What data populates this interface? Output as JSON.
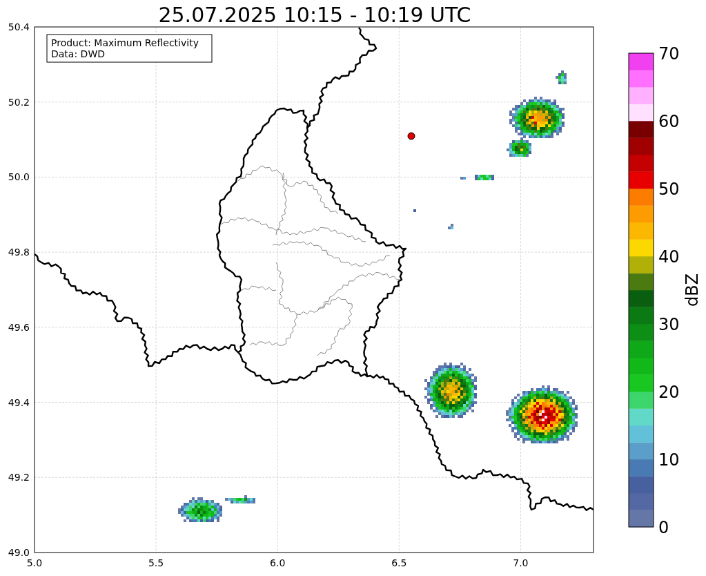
{
  "title": "25.07.2025 10:15 - 10:19 UTC",
  "info_box": [
    "Product: Maximum Reflectivity",
    "Data: DWD"
  ],
  "map": {
    "x_ticks": [
      "5.0",
      "5.5",
      "6.0",
      "6.5",
      "7.0"
    ],
    "y_ticks": [
      "50.4",
      "50.2",
      "50.0",
      "49.8",
      "49.6",
      "49.4",
      "49.2",
      "49.0"
    ]
  },
  "colorbar": {
    "label": "dBZ",
    "ticks": [
      "70",
      "60",
      "50",
      "40",
      "30",
      "20",
      "10",
      "0"
    ],
    "bands": [
      {
        "color": "#6577a6"
      },
      {
        "color": "#5468a3"
      },
      {
        "color": "#4660a0"
      },
      {
        "color": "#4a7ab4"
      },
      {
        "color": "#5a9ec9"
      },
      {
        "color": "#62c0d8"
      },
      {
        "color": "#62d8c8"
      },
      {
        "color": "#3cd66c"
      },
      {
        "color": "#18c820"
      },
      {
        "color": "#10b818"
      },
      {
        "color": "#0fa818"
      },
      {
        "color": "#0d8e14"
      },
      {
        "color": "#0b7a12"
      },
      {
        "color": "#0a5e10"
      },
      {
        "color": "#4a7a10"
      },
      {
        "color": "#b0b008"
      },
      {
        "color": "#fcd800"
      },
      {
        "color": "#fcb800"
      },
      {
        "color": "#fc9c00"
      },
      {
        "color": "#fc7c00"
      },
      {
        "color": "#e80000"
      },
      {
        "color": "#c40000"
      },
      {
        "color": "#a00000"
      },
      {
        "color": "#780000"
      },
      {
        "color": "#ffe0ff"
      },
      {
        "color": "#ffb0ff"
      },
      {
        "color": "#ff70ff"
      },
      {
        "color": "#f040f0"
      }
    ]
  }
}
